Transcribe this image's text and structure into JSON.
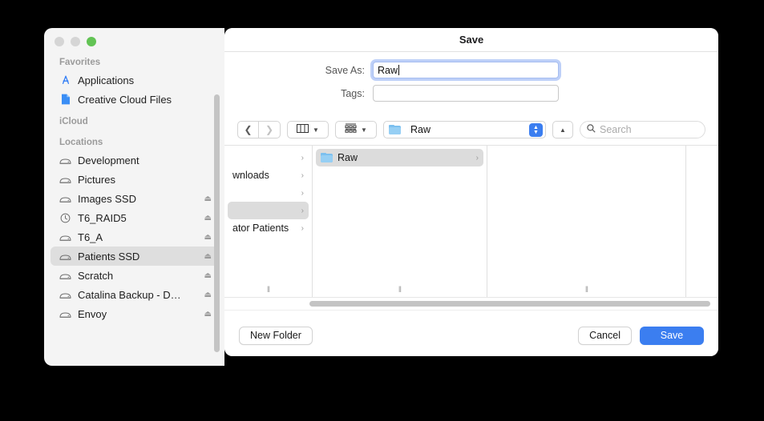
{
  "window": {
    "title": "Save",
    "traffic_lights": [
      {
        "name": "close",
        "color": "#d5d5d5"
      },
      {
        "name": "minimize",
        "color": "#d5d5d5"
      },
      {
        "name": "zoom",
        "color": "#62c354"
      }
    ]
  },
  "form": {
    "save_as_label": "Save As:",
    "save_as_value": "Raw",
    "tags_label": "Tags:",
    "tags_value": ""
  },
  "toolbar": {
    "back_icon": "chevron-left",
    "forward_icon": "chevron-right",
    "view_icon": "column-view-icon",
    "group_icon": "group-by-icon",
    "dropdown_icon": "chevron-down",
    "path_label": "Raw",
    "path_icon": "folder-icon",
    "stepper_icon": "up-down-chevrons",
    "up_icon": "chevron-up",
    "search_icon": "search-icon",
    "search_placeholder": "Search",
    "search_value": ""
  },
  "browser": {
    "column_a": [
      {
        "label": "",
        "chevron": "›",
        "selected": false
      },
      {
        "label": "wnloads",
        "chevron": "›",
        "selected": false
      },
      {
        "label": "",
        "chevron": "›",
        "selected": false
      },
      {
        "label": "",
        "chevron": "›",
        "selected": true
      },
      {
        "label": "ator Patients",
        "chevron": "›",
        "selected": false
      }
    ],
    "column_b": [
      {
        "label": "Raw",
        "chevron": "›",
        "selected": true,
        "icon": "folder-icon"
      }
    ],
    "resize_grip": "‖"
  },
  "buttons": {
    "new_folder": "New Folder",
    "cancel": "Cancel",
    "save": "Save"
  },
  "sidebar": {
    "sections": [
      {
        "header": "Favorites",
        "items": [
          {
            "label": "Applications",
            "icon": "app-store-icon",
            "eject": false,
            "selected": false
          },
          {
            "label": "Creative Cloud Files",
            "icon": "document-icon",
            "eject": false,
            "selected": false
          }
        ]
      },
      {
        "header": "iCloud",
        "items": []
      },
      {
        "header": "Locations",
        "items": [
          {
            "label": "Development",
            "icon": "drive-icon",
            "eject": false,
            "selected": false
          },
          {
            "label": "Pictures",
            "icon": "drive-icon",
            "eject": false,
            "selected": false
          },
          {
            "label": "Images SSD",
            "icon": "drive-icon",
            "eject": true,
            "selected": false
          },
          {
            "label": "T6_RAID5",
            "icon": "clock-icon",
            "eject": true,
            "selected": false
          },
          {
            "label": "T6_A",
            "icon": "drive-icon",
            "eject": true,
            "selected": false
          },
          {
            "label": "Patients SSD",
            "icon": "drive-icon",
            "eject": true,
            "selected": true
          },
          {
            "label": "Scratch",
            "icon": "drive-icon",
            "eject": true,
            "selected": false
          },
          {
            "label": "Catalina Backup - D…",
            "icon": "drive-icon",
            "eject": true,
            "selected": false
          },
          {
            "label": "Envoy",
            "icon": "drive-icon",
            "eject": true,
            "selected": false
          }
        ]
      }
    ],
    "eject_glyph": "⏏"
  },
  "colors": {
    "accent": "#3b7ef0",
    "selection": "#dcdcdc",
    "sidebar_bg": "#f4f4f4",
    "folder_blue": "#96cff4",
    "zoom_green": "#62c354"
  }
}
